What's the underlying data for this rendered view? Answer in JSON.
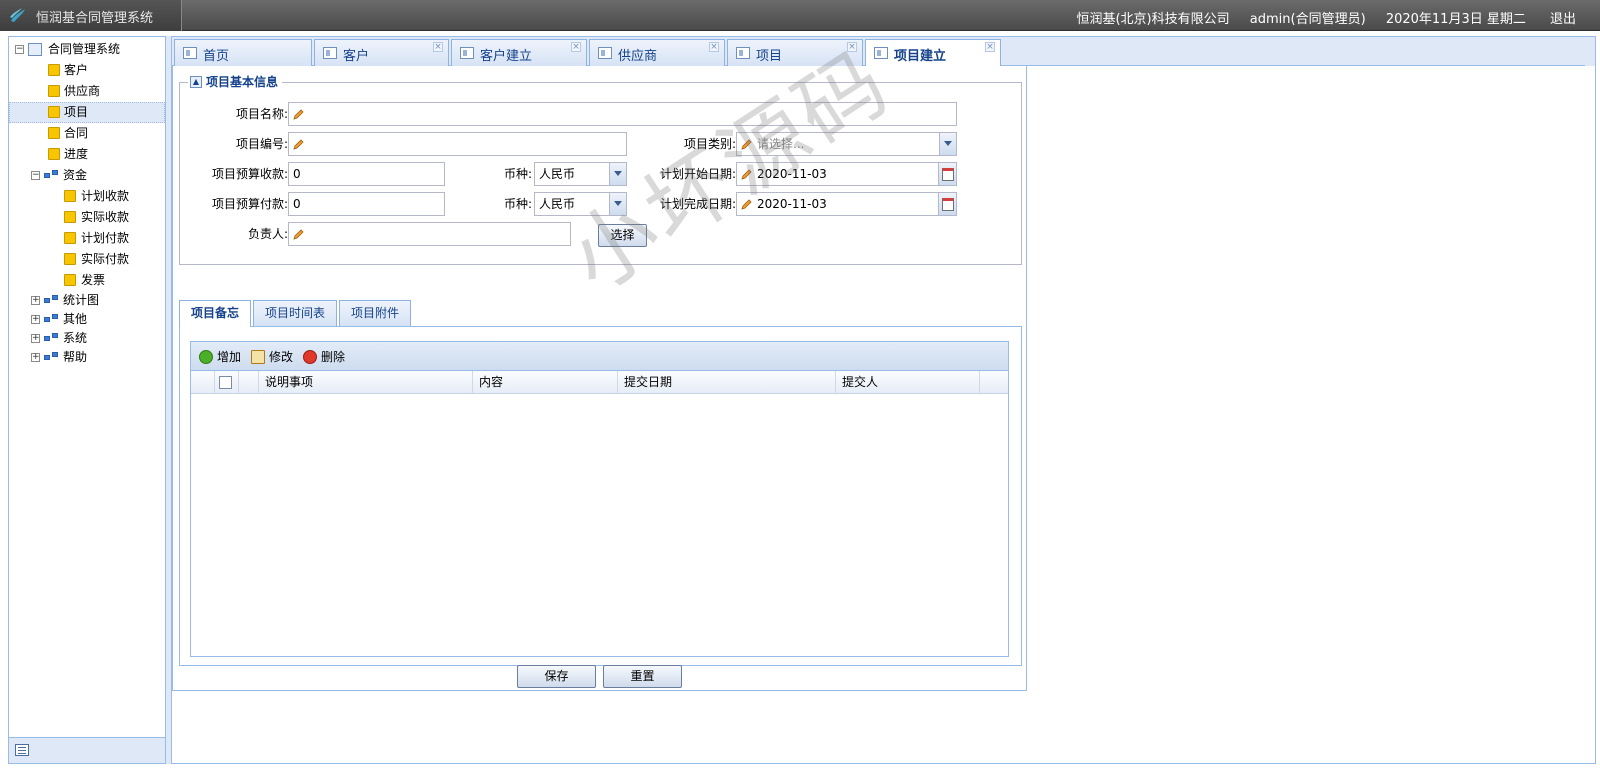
{
  "app": {
    "title": "恒润基合同管理系统",
    "company": "恒润基(北京)科技有限公司",
    "user": "admin(合同管理员)",
    "date": "2020年11月3日 星期二",
    "logout": "退出"
  },
  "tree": {
    "root": "合同管理系统",
    "items": [
      "客户",
      "供应商",
      "项目",
      "合同",
      "进度"
    ],
    "fund": {
      "label": "资金",
      "children": [
        "计划收款",
        "实际收款",
        "计划付款",
        "实际付款",
        "发票"
      ]
    },
    "groups": [
      "统计图",
      "其他",
      "系统",
      "帮助"
    ],
    "selected": "项目"
  },
  "tabs": [
    {
      "label": "首页",
      "closable": false
    },
    {
      "label": "客户",
      "closable": true
    },
    {
      "label": "客户建立",
      "closable": true
    },
    {
      "label": "供应商",
      "closable": true
    },
    {
      "label": "项目",
      "closable": true
    },
    {
      "label": "项目建立",
      "closable": true,
      "active": true
    }
  ],
  "form": {
    "legend": "项目基本信息",
    "name_label": "项目名称:",
    "name_value": "",
    "code_label": "项目编号:",
    "code_value": "",
    "category_label": "项目类别:",
    "category_placeholder": "请选择...",
    "budget_in_label": "项目预算收款:",
    "budget_in_value": "0",
    "currency_label": "币种:",
    "currency_in": "人民币",
    "start_label": "计划开始日期:",
    "start_value": "2020-11-03",
    "budget_out_label": "项目预算付款:",
    "budget_out_value": "0",
    "currency_out": "人民币",
    "end_label": "计划完成日期:",
    "end_value": "2020-11-03",
    "owner_label": "负责人:",
    "owner_value": "",
    "choose_button": "选择"
  },
  "subtabs": [
    "项目备忘",
    "项目时间表",
    "项目附件"
  ],
  "grid": {
    "toolbar": [
      "增加",
      "修改",
      "删除"
    ],
    "columns": [
      "说明事项",
      "内容",
      "提交日期",
      "提交人"
    ]
  },
  "actions": {
    "save": "保存",
    "reset": "重置"
  },
  "watermark": "小坏源码"
}
